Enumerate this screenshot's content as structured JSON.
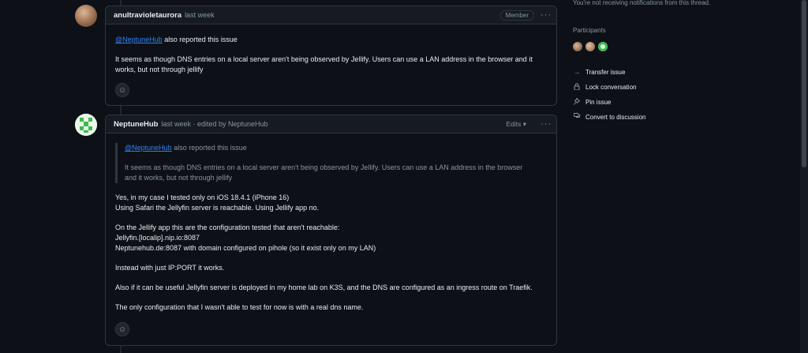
{
  "comments": [
    {
      "author": "anultravioletaurora",
      "meta": "last week",
      "badge": "Member",
      "mention": "@NeptuneHub",
      "mention_suffix": " also reported this issue",
      "paragraph": "It seems as though DNS entries on a local server aren't being observed by Jellify. Users can use a LAN address in the browser and it works, but not through jellify"
    },
    {
      "author": "NeptuneHub",
      "meta": "last week · edited by NeptuneHub",
      "edits_label": "Edits",
      "quote_mention": "@NeptuneHub",
      "quote_suffix": " also reported this issue",
      "quote_line1": "It seems as though DNS entries on a local server aren't being observed by Jellify. Users can use a LAN address in the browser",
      "quote_line2": "and it works, but not through jellify",
      "p1_line1": "Yes, in my case I tested only on iOS 18.4.1 (iPhone 16)",
      "p1_line2": "Using Safari the Jellyfin server is reachable. Using Jellify app no.",
      "p2_line1": "On the Jellify app this are the configuration tested that aren't reachable:",
      "p2_line2": "Jellyfin.[localip].nip.io:8087",
      "p2_line3": "Neptunehub.de:8087 with domain configured on pihole (so it exist only on my LAN)",
      "p3": "Instead with just IP:PORT it works.",
      "p4": "Also if it can be useful Jellyfin server is deployed in my home lab on K3S, and the DNS are configured as an ingress route on Traefik.",
      "p5": "The only configuration that I wasn't able to test for now is with a real dns name."
    }
  ],
  "sidebar": {
    "notification_text": "You're not receiving notifications from this thread.",
    "participants_label": "Participants",
    "actions": [
      "Transfer issue",
      "Lock conversation",
      "Pin issue",
      "Convert to discussion"
    ]
  },
  "icons": {
    "kebab": "kebab-horizontal-icon",
    "smiley": "smiley-icon",
    "transfer": "arrow-right-icon",
    "lock": "lock-icon",
    "pin": "pin-icon",
    "discussion": "comment-discussion-icon",
    "caret": "triangle-down-icon"
  }
}
